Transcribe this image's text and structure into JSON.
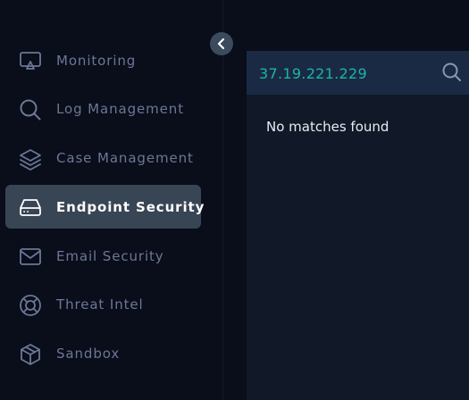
{
  "sidebar": {
    "collapse_icon": "chevron-left-icon",
    "items": [
      {
        "label": "Monitoring",
        "icon": "monitor-icon",
        "active": false
      },
      {
        "label": "Log Management",
        "icon": "search-icon",
        "active": false
      },
      {
        "label": "Case Management",
        "icon": "layers-icon",
        "active": false
      },
      {
        "label": "Endpoint Security",
        "icon": "hard-drive-icon",
        "active": true
      },
      {
        "label": "Email Security",
        "icon": "mail-icon",
        "active": false
      },
      {
        "label": "Threat Intel",
        "icon": "lifebuoy-icon",
        "active": false
      },
      {
        "label": "Sandbox",
        "icon": "box-icon",
        "active": false
      }
    ]
  },
  "main": {
    "search": {
      "value": "37.19.221.229",
      "icon": "search-icon"
    },
    "empty_message": "No matches found"
  },
  "colors": {
    "background": "#0a0d1a",
    "active_item": "#384554",
    "search_bar": "#1a2a45",
    "search_text": "#1bb5a6",
    "panel": "#111827",
    "nav_text": "#6b7896"
  }
}
